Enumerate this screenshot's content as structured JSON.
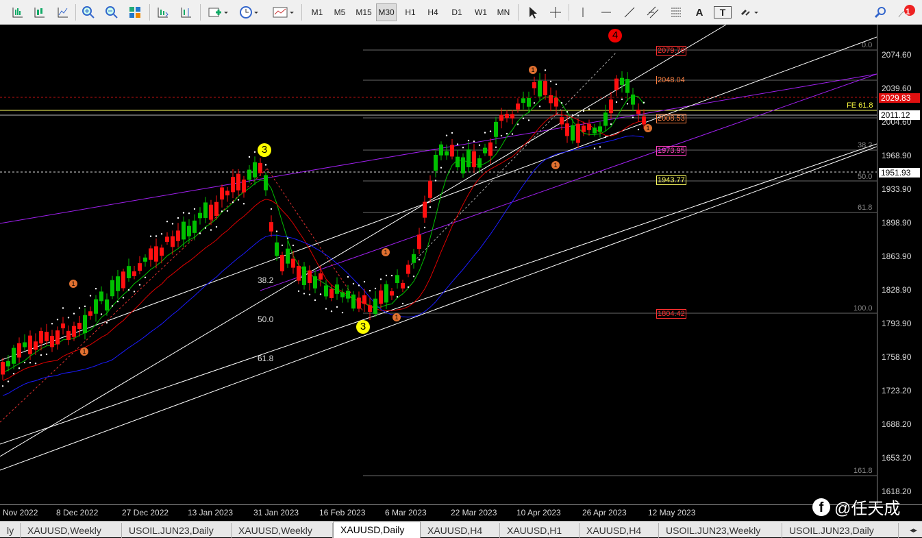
{
  "toolbar": {
    "timeframes": [
      "M1",
      "M5",
      "M15",
      "M30",
      "H1",
      "H4",
      "D1",
      "W1",
      "MN"
    ],
    "active_timeframe": "M30",
    "notification_count": "1",
    "text_tool": "A",
    "text_label_tool": "T"
  },
  "chart": {
    "symbol": "XAUUSD,Daily",
    "ask_price": "2029.83",
    "bid_price": "2011.12",
    "marked_price": "1951.93",
    "wave_labels": [
      "4",
      "3",
      "3"
    ],
    "fibo_ret_levels": [
      "0.0",
      "38.2",
      "50.0",
      "61.8",
      "100.0",
      "161.8"
    ],
    "fibo_ret_prices": [
      "2079.76",
      "2048.04",
      "2008.53",
      "1973.95",
      "1943.77",
      "1804.42"
    ],
    "fe_label": "FE 61.8",
    "channel_fibo": [
      "38.2",
      "50.0",
      "61.8"
    ],
    "minor_wave_marks": [
      "1",
      "1",
      "1",
      "1",
      "1",
      "1",
      "1"
    ],
    "colors": {
      "bull": "#00c000",
      "bear": "#ff1010",
      "ma_fast": "#00c000",
      "ma_mid": "#e00000",
      "ma_slow": "#1a1aff",
      "channel": "#a020f0"
    }
  },
  "yaxis": {
    "ticks": [
      "2074.60",
      "2039.60",
      "2004.60",
      "1968.90",
      "1933.90",
      "1898.90",
      "1863.90",
      "1828.90",
      "1793.90",
      "1758.90",
      "1723.20",
      "1688.20",
      "1653.20",
      "1618.20"
    ]
  },
  "xaxis": {
    "ticks": [
      "Nov 2022",
      "8 Dec 2022",
      "27 Dec 2022",
      "13 Jan 2023",
      "31 Jan 2023",
      "16 Feb 2023",
      "6 Mar 2023",
      "22 Mar 2023",
      "10 Apr 2023",
      "26 Apr 2023",
      "12 May 2023"
    ]
  },
  "tabs": [
    "ly",
    "XAUUSD,Weekly",
    "USOIL.JUN23,Daily",
    "XAUUSD,Weekly",
    "XAUUSD,Daily",
    "XAUUSD,H4",
    "XAUUSD,H1",
    "XAUUSD,H4",
    "USOIL.JUN23,Weekly",
    "USOIL.JUN23,Daily"
  ],
  "active_tab": "XAUUSD,Daily",
  "watermark": "@任天成"
}
